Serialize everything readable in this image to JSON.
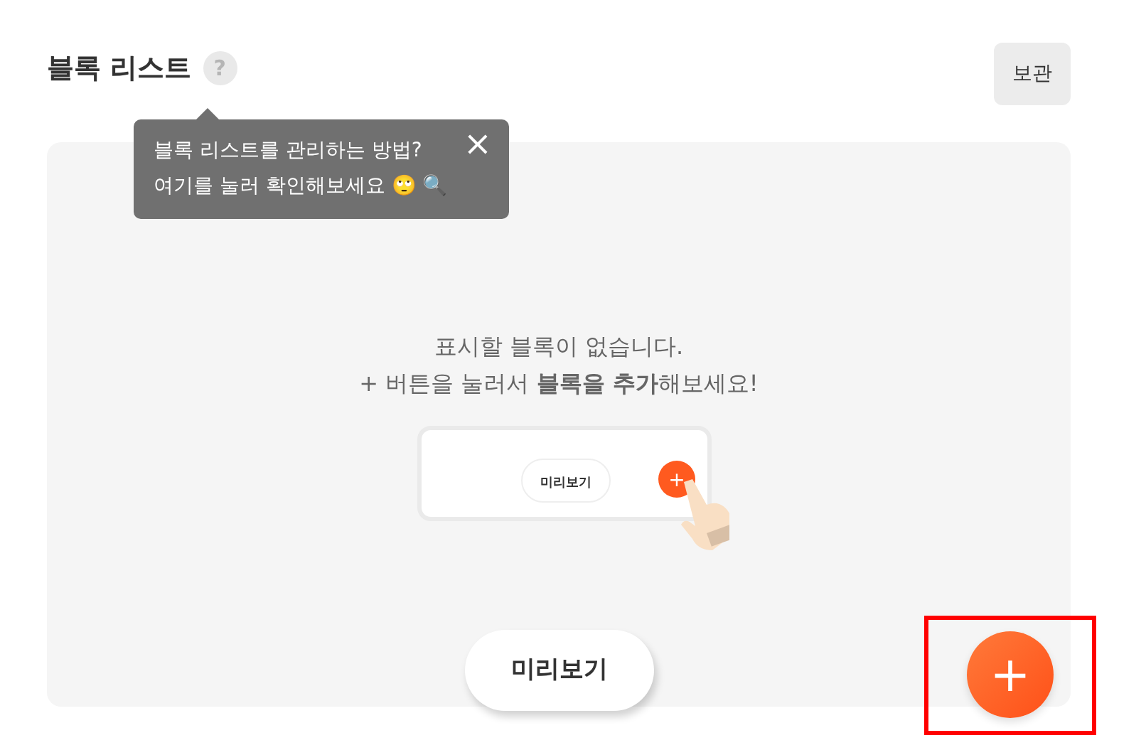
{
  "header": {
    "title": "블록 리스트",
    "help": "?",
    "archive_button": "보관"
  },
  "tooltip": {
    "lines": [
      "블록 리스트를 관리하는 방법?",
      "여기를 눌러 확인해보세요 🙄 🔍"
    ],
    "close": "×"
  },
  "empty_state": {
    "line1": "표시할 블록이 없습니다.",
    "line2": "+ 버튼을 눌러서 **블록을 추가**해보세요!",
    "illustration": {
      "preview_label": "미리보기",
      "plus": "+"
    }
  },
  "preview_button": "미리보기",
  "add_button": {
    "label": "+",
    "highlighted": true
  }
}
